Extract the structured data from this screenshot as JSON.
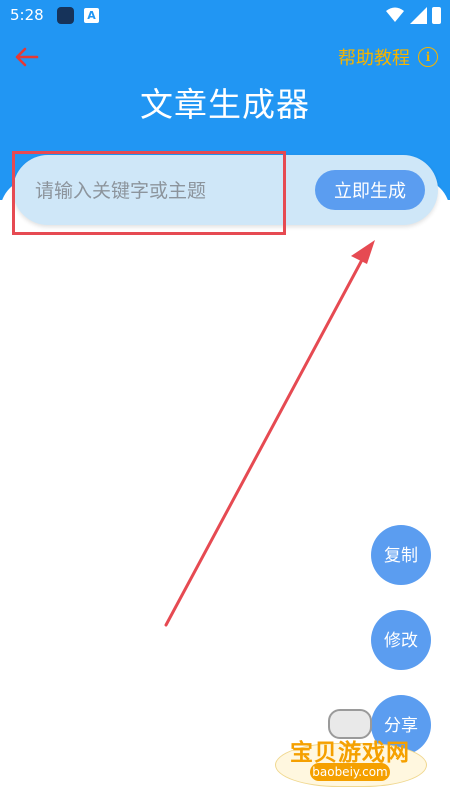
{
  "status_bar": {
    "time": "5:28",
    "icons": [
      "app-notification-icon",
      "a-icon",
      "wifi-icon",
      "signal-icon",
      "battery-icon"
    ]
  },
  "header": {
    "back_icon": "arrow-left-icon",
    "help_label": "帮助教程",
    "help_icon": "info-icon",
    "title": "文章生成器"
  },
  "search": {
    "placeholder": "请输入关键字或主题",
    "value": "",
    "button_label": "立即生成"
  },
  "actions": {
    "copy_label": "复制",
    "edit_label": "修改",
    "share_label": "分享"
  },
  "watermark": {
    "name": "宝贝游戏网",
    "url": "baobeiy.com"
  },
  "colors": {
    "header_blue": "#2196f3",
    "accent_blue": "#5b9df0",
    "input_bg": "#cfe7f8",
    "help_gold": "#f4b400",
    "annotation_red": "#e64a52",
    "back_arrow_red": "#e53935"
  }
}
